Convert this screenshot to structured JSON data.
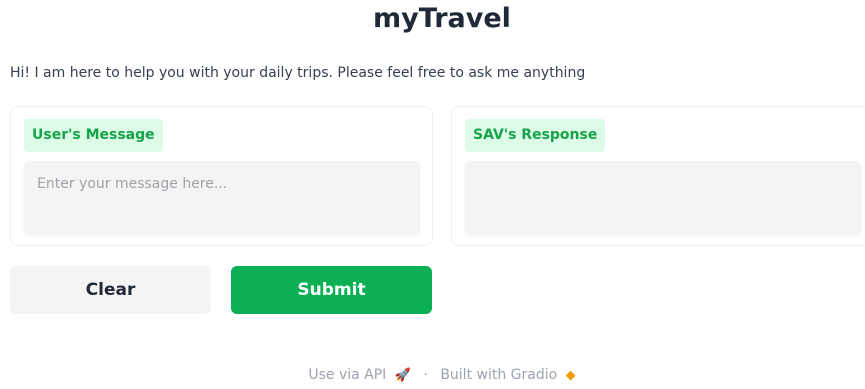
{
  "app": {
    "title": "myTravel",
    "description": "Hi! I am here to help you with your daily trips. Please feel free to ask me anything"
  },
  "input_panel": {
    "label": "User's Message",
    "placeholder": "Enter your message here...",
    "value": ""
  },
  "output_panel": {
    "label": "SAV's Response",
    "value": ""
  },
  "buttons": {
    "clear_label": "Clear",
    "submit_label": "Submit"
  },
  "footer": {
    "api_label": "Use via API",
    "api_icon": "rocket-icon",
    "separator": "·",
    "built_with_label": "Built with Gradio",
    "gradio_icon": "gradio-logo-icon"
  },
  "colors": {
    "accent": "#0bb055",
    "label_bg": "#dcfce7",
    "label_text": "#16a34a",
    "input_bg": "#f4f4f5"
  }
}
